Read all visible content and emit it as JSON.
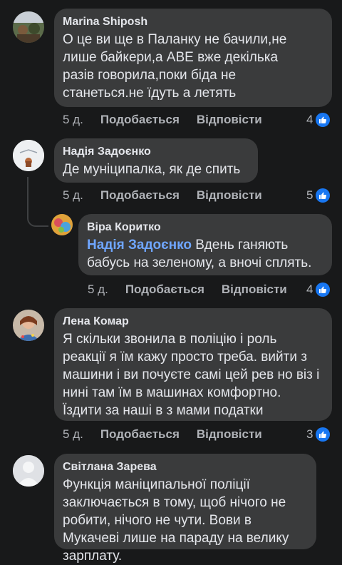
{
  "comments": [
    {
      "author": "Marina Shiposh",
      "text": "О це ви ще в Паланку не бачили,не лише байкери,а АВЕ вже декілька разів говорила,поки біда не станеться.не їдуть а летять",
      "time": "5 д.",
      "like_label": "Подобається",
      "reply_label": "Відповісти",
      "reaction_count": "4"
    },
    {
      "author": "Надія Задоєнко",
      "text": "Де муніципалка, як де спить",
      "time": "5 д.",
      "like_label": "Подобається",
      "reply_label": "Відповісти",
      "reaction_count": "5",
      "replies": [
        {
          "author": "Віра Коритко",
          "mention": "Надія Задоєнко",
          "text": "Вдень ганяють бабусь на зеленому, а вночі сплять.",
          "time": "5 д.",
          "like_label": "Подобається",
          "reply_label": "Відповісти",
          "reaction_count": "4"
        }
      ]
    },
    {
      "author": "Лена Комар",
      "text": "Я скільки звонила в поліцію і роль реакції я їм кажу просто треба. вийти з машини і ви почуєте самі цей рев но віз і нині там їм в машинах комфортно. Їздити за наші в з мами податки",
      "time": "5 д.",
      "like_label": "Подобається",
      "reply_label": "Відповісти",
      "reaction_count": "3"
    },
    {
      "author": "Світлана Зарева",
      "text": "Функція маніципальної поліції заключається в  тому, щоб нічого  не робити, нічого не чути. Вови в Мукачеві лише на параду на велику зарплату."
    }
  ],
  "icons": {
    "like": "thumbs-up-icon",
    "avatar_default": "default-user-icon"
  },
  "colors": {
    "background": "#18191a",
    "bubble": "#3a3b3c",
    "like": "#1877f2",
    "mention": "#6fa6ff"
  }
}
